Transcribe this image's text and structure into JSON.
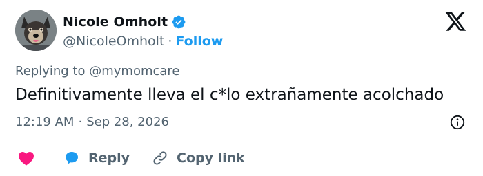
{
  "author": {
    "display_name": "Nicole Omholt",
    "handle": "@NicoleOmholt",
    "separator": "·",
    "follow_label": "Follow"
  },
  "tweet": {
    "replying_prefix": "Replying to",
    "replying_to": "@mymomcare",
    "text": "Definitivamente lleva el c*lo extrañamente acolchado",
    "time": "12:19 AM",
    "meta_separator": "·",
    "date": "Sep 28, 2026"
  },
  "actions": {
    "like_icon": "heart-icon",
    "reply_label": "Reply",
    "copy_link_label": "Copy link"
  },
  "icons": {
    "verified": "verified-badge-icon",
    "brand": "x-logo-icon",
    "info": "info-icon"
  },
  "colors": {
    "accent": "#1d9bf0",
    "like": "#f91880",
    "muted_text": "#536471",
    "primary_text": "#0f1419"
  }
}
